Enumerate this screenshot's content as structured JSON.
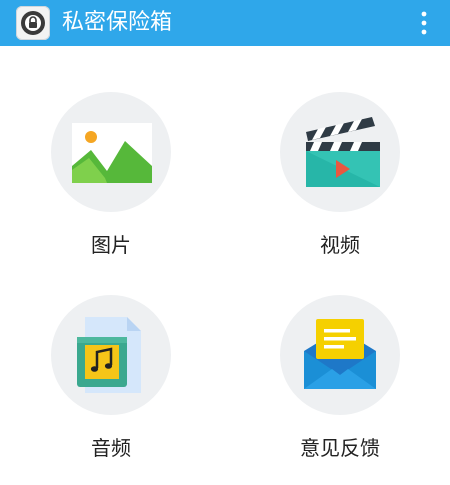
{
  "app_bar": {
    "title": "私密保险箱",
    "app_icon": "vault-lock-icon",
    "overflow_icon": "more-vert-icon",
    "background": "#2fa7ea"
  },
  "grid": {
    "items": [
      {
        "label": "图片",
        "icon": "image-icon"
      },
      {
        "label": "视频",
        "icon": "video-clapper-icon"
      },
      {
        "label": "音频",
        "icon": "audio-file-icon"
      },
      {
        "label": "意见反馈",
        "icon": "feedback-envelope-icon"
      }
    ]
  }
}
